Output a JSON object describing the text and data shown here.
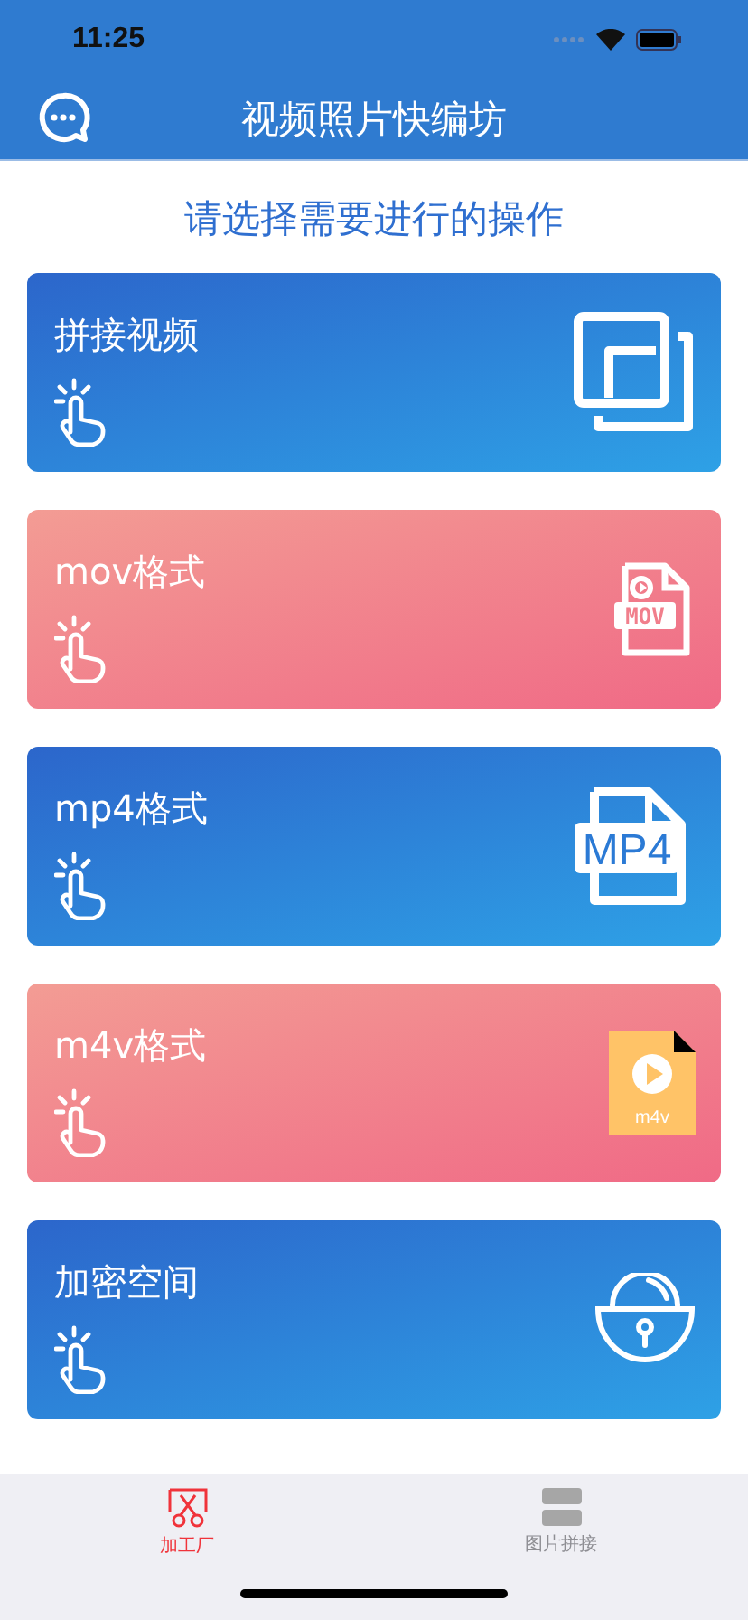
{
  "status_bar": {
    "time": "11:25"
  },
  "nav": {
    "title": "视频照片快编坊"
  },
  "prompt": "请选择需要进行的操作",
  "cards": [
    {
      "title": "拼接视频",
      "color": "#2c66cb",
      "kind": "stack"
    },
    {
      "title": "mov格式",
      "color": "#f39c94",
      "kind": "mov",
      "icon_text": "MOV"
    },
    {
      "title": "mp4格式",
      "color": "#2c66cb",
      "kind": "mp4",
      "icon_text": "MP4"
    },
    {
      "title": "m4v格式",
      "color": "#f39c94",
      "kind": "m4v",
      "icon_text": "m4v"
    },
    {
      "title": "加密空间",
      "color": "#2c66cb",
      "kind": "lock"
    }
  ],
  "tabs": [
    {
      "label": "加工厂",
      "kind": "scissors",
      "selected": true
    },
    {
      "label": "图片拼接",
      "kind": "blocks",
      "selected": false
    }
  ]
}
